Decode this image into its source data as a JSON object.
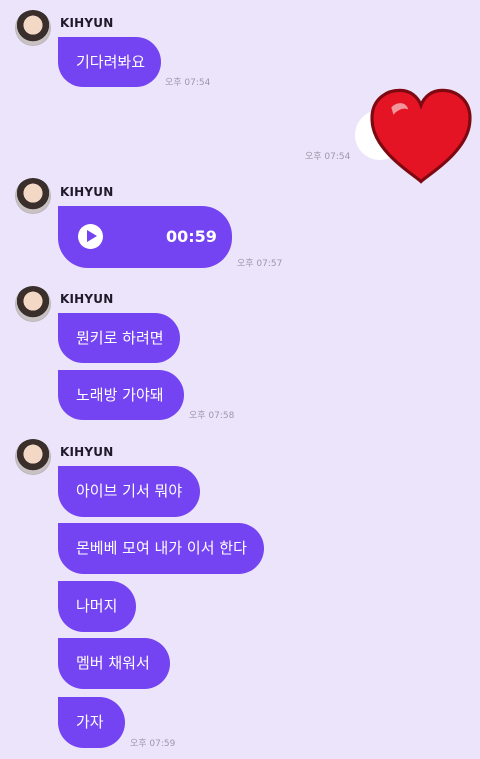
{
  "chat": {
    "groups": [
      {
        "sender": "KIHYUN",
        "messages": [
          "기다려봐요"
        ],
        "time": "오후 07:54"
      },
      {
        "sent_sticker_time": "오후 07:54"
      },
      {
        "sender": "KIHYUN",
        "voice_duration": "00:59",
        "time": "오후 07:57"
      },
      {
        "sender": "KIHYUN",
        "messages": [
          "뭔키로 하려면",
          "노래방 가야돼"
        ],
        "time": "오후 07:58"
      },
      {
        "sender": "KIHYUN",
        "messages": [
          "아이브 기서 뭐야",
          "몬베베 모여 내가 이서 한다",
          "나머지",
          "멤버 채워서",
          "가자"
        ],
        "time": "오후 07:59"
      }
    ]
  },
  "colors": {
    "background": "#ebe4fb",
    "bubble": "#7443f2",
    "bubble_text": "#ffffff",
    "timestamp": "#9c98a8",
    "heart": "#e41424"
  },
  "icons": {
    "voice_play": "play-icon",
    "sticker": "heart-icon"
  }
}
